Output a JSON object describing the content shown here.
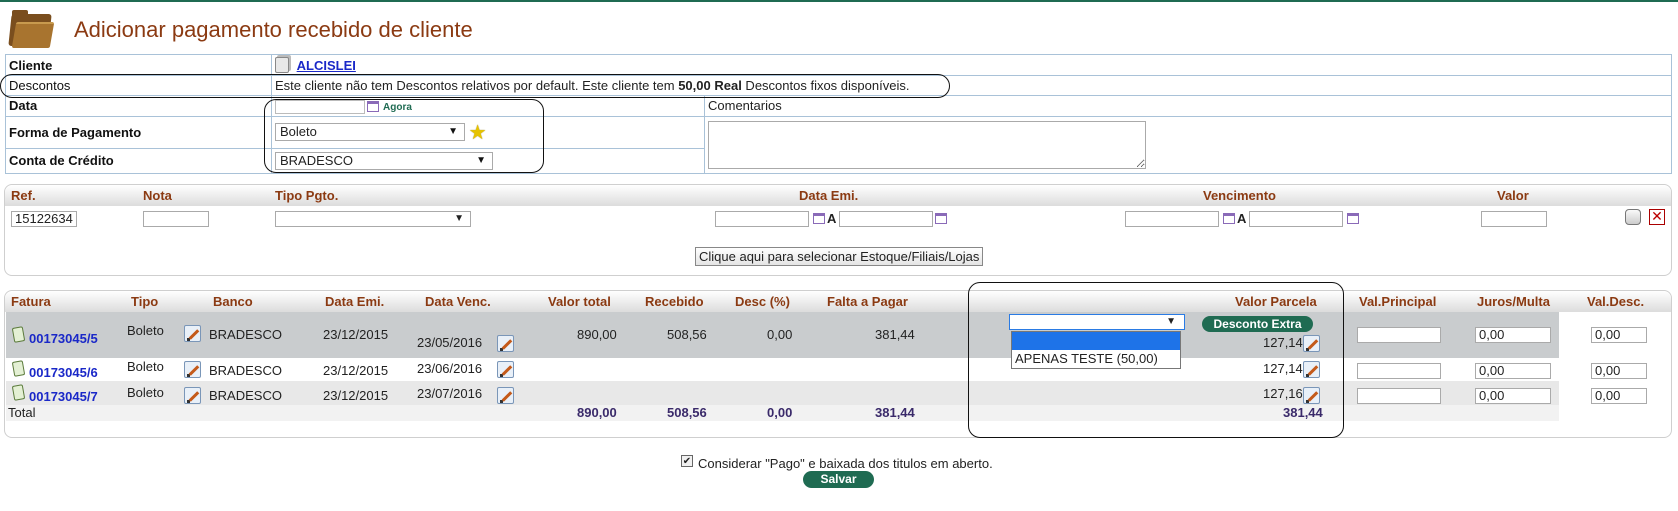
{
  "page": {
    "title": "Adicionar pagamento recebido de cliente"
  },
  "info": {
    "cliente_label": "Cliente",
    "cliente_value": "ALCISLEI",
    "descontos_label": "Descontos",
    "descontos_text_1": "Este cliente não tem Descontos relativos por default. Este cliente tem ",
    "descontos_amount": "50,00 Real",
    "descontos_text_2": " Descontos fixos disponíveis.",
    "data_label": "Data",
    "agora_label": "Agora",
    "comentarios_label": "Comentarios",
    "forma_label": "Forma de Pagamento",
    "forma_value": "Boleto",
    "conta_label": "Conta de Crédito",
    "conta_value": "BRADESCO"
  },
  "filter": {
    "headers": {
      "ref": "Ref.",
      "nota": "Nota",
      "tipo": "Tipo Pgto.",
      "data_emi": "Data Emi.",
      "vencimento": "Vencimento",
      "valor": "Valor"
    },
    "ref_value": "15122634",
    "range_sep": "A",
    "stock_button": "Clique aqui para selecionar Estoque/Filiais/Lojas"
  },
  "invoices": {
    "headers": {
      "fatura": "Fatura",
      "tipo": "Tipo",
      "banco": "Banco",
      "data_emi": "Data Emi.",
      "data_venc": "Data Venc.",
      "valor_total": "Valor total",
      "recebido": "Recebido",
      "desc": "Desc (%)",
      "falta": "Falta a Pagar",
      "valor_parcela": "Valor Parcela",
      "val_principal": "Val.Principal",
      "juros": "Juros/Multa",
      "val_desc": "Val.Desc."
    },
    "rows": [
      {
        "fatura": "00173045/5",
        "tipo": "Boleto",
        "banco": "BRADESCO",
        "data_emi": "23/12/2015",
        "data_venc": "23/05/2016",
        "valor_total": "890,00",
        "recebido": "508,56",
        "desc": "0,00",
        "falta": "381,44",
        "parcela": "127,14",
        "juros": "0,00",
        "val_desc": "0,00"
      },
      {
        "fatura": "00173045/6",
        "tipo": "Boleto",
        "banco": "BRADESCO",
        "data_emi": "23/12/2015",
        "data_venc": "23/06/2016",
        "parcela": "127,14",
        "juros": "0,00",
        "val_desc": "0,00"
      },
      {
        "fatura": "00173045/7",
        "tipo": "Boleto",
        "banco": "BRADESCO",
        "data_emi": "23/12/2015",
        "data_venc": "23/07/2016",
        "parcela": "127,16",
        "juros": "0,00",
        "val_desc": "0,00"
      }
    ],
    "total": {
      "label": "Total",
      "valor_total": "890,00",
      "recebido": "508,56",
      "desc": "0,00",
      "falta": "381,44",
      "parcela": "381,44"
    },
    "desconto_extra_button": "Desconto Extra",
    "dropdown_option": "APENAS TESTE (50,00)"
  },
  "footer": {
    "checkbox_label": "Considerar \"Pago\" e baixada dos titulos em aberto.",
    "save_button": "Salvar"
  }
}
